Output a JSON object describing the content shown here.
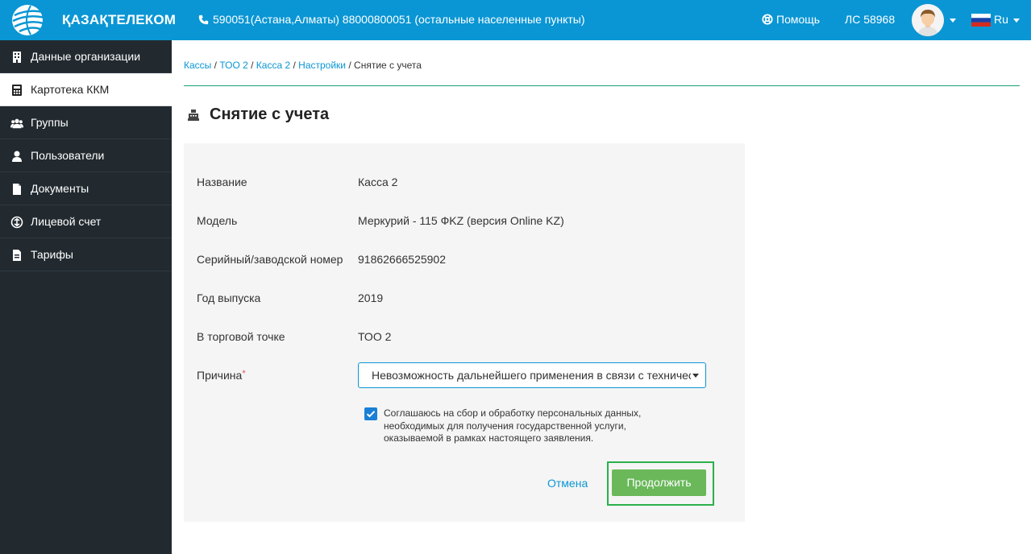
{
  "header": {
    "brand": "ҚАЗАҚТЕЛЕКОМ",
    "phone": "590051(Астана,Алматы) 88000800051 (остальные населенные пункты)",
    "help": "Помощь",
    "account": "ЛС 58968",
    "language": "Ru",
    "bg_color": "#0a96d4"
  },
  "sidebar": {
    "items": [
      {
        "label": "Данные организации",
        "icon": "building-icon"
      },
      {
        "label": "Картотека ККМ",
        "icon": "calculator-icon",
        "active": true
      },
      {
        "label": "Группы",
        "icon": "group-icon"
      },
      {
        "label": "Пользователи",
        "icon": "user-icon"
      },
      {
        "label": "Документы",
        "icon": "document-icon"
      },
      {
        "label": "Лицевой счет",
        "icon": "money-icon"
      },
      {
        "label": "Тарифы",
        "icon": "tariff-icon"
      }
    ]
  },
  "breadcrumb": {
    "items": [
      "Кассы",
      "ТОО 2",
      "Касса 2",
      "Настройки"
    ],
    "current": "Снятие с учета"
  },
  "page": {
    "title": "Снятие с учета"
  },
  "form": {
    "fields": [
      {
        "label": "Название",
        "value": "Касса 2"
      },
      {
        "label": "Модель",
        "value": "Меркурий - 115 ФKZ (версия Online KZ)"
      },
      {
        "label": "Серийный/заводской номер",
        "value": "91862666525902"
      },
      {
        "label": "Год выпуска",
        "value": "2019"
      },
      {
        "label": "В торговой точке",
        "value": "ТОО 2"
      }
    ],
    "reason_label": "Причина",
    "reason_required": "*",
    "reason_value": "Невозможность дальнейшего применения в связи с технической неисправностью",
    "consent_checked": true,
    "consent_text": "Соглашаюсь на сбор и обработку персональных данных, необходимых для получения государственной услуги, оказываемой в рамках настоящего заявления.",
    "cancel_label": "Отмена",
    "continue_label": "Продолжить"
  }
}
